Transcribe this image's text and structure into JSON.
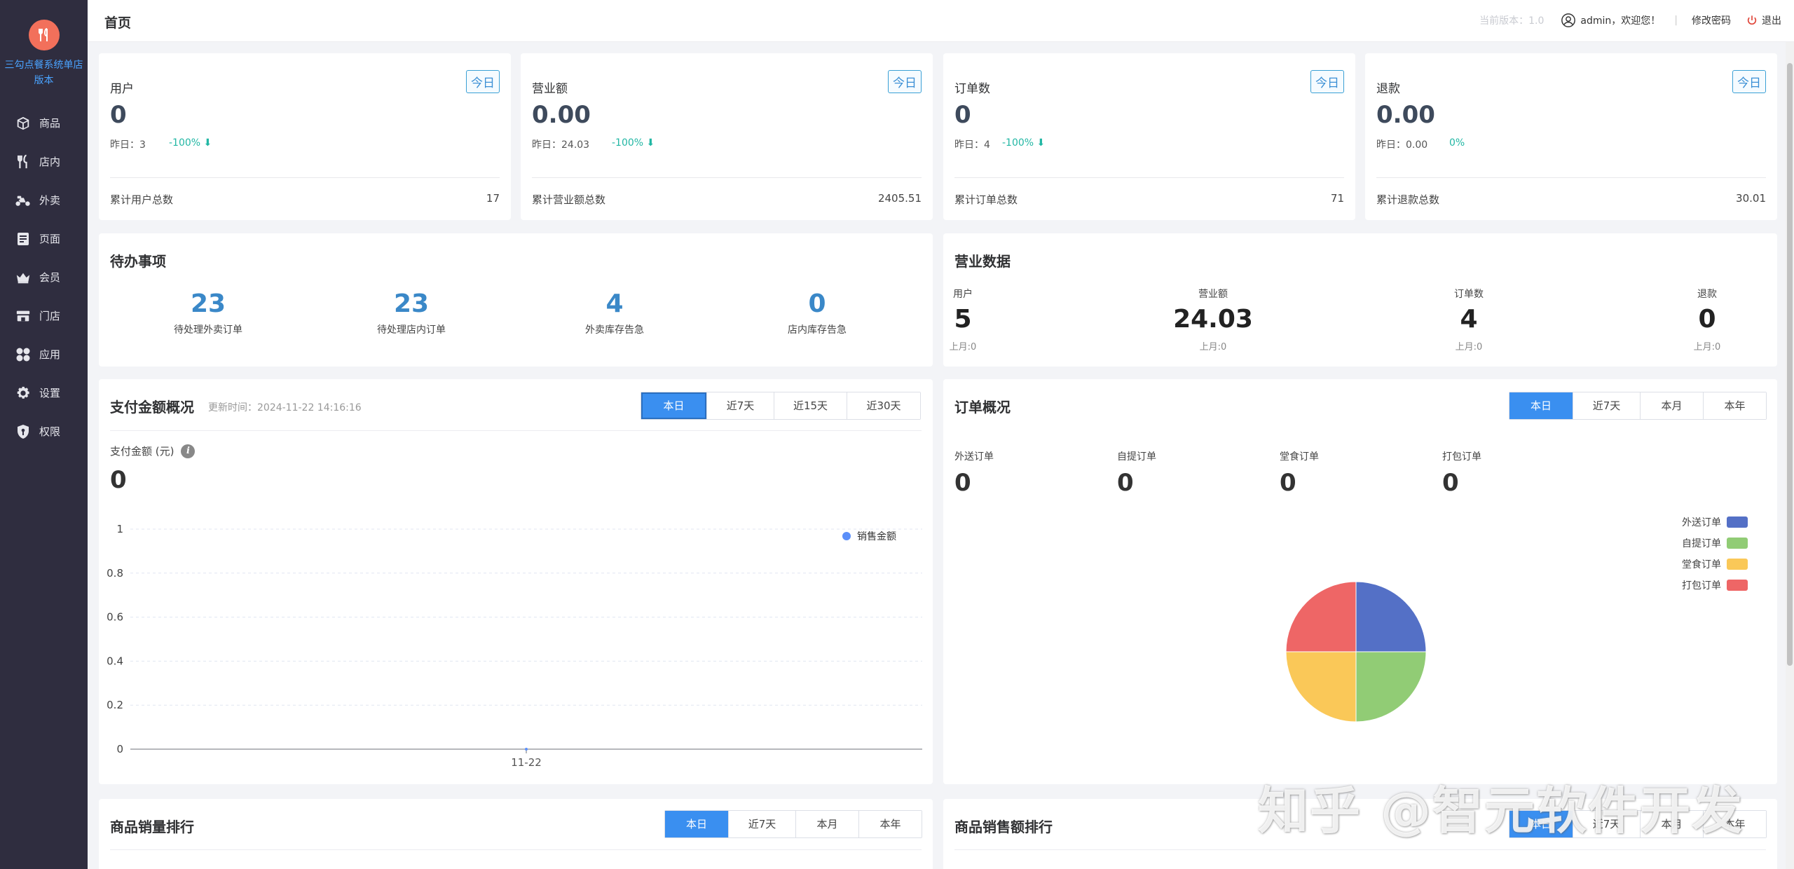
{
  "sidebar": {
    "brand": "三勾点餐系统单店版本",
    "items": [
      {
        "label": "商品",
        "icon": "box-icon"
      },
      {
        "label": "店内",
        "icon": "utensils-icon"
      },
      {
        "label": "外卖",
        "icon": "scooter-icon"
      },
      {
        "label": "页面",
        "icon": "page-icon"
      },
      {
        "label": "会员",
        "icon": "crown-icon"
      },
      {
        "label": "门店",
        "icon": "store-icon"
      },
      {
        "label": "应用",
        "icon": "apps-icon"
      },
      {
        "label": "设置",
        "icon": "gear-icon"
      },
      {
        "label": "权限",
        "icon": "shield-icon"
      }
    ]
  },
  "header": {
    "title": "首页",
    "version": "当前版本：1.0",
    "user": "admin，欢迎您！",
    "separator": "|",
    "change_password": "修改密码",
    "logout": "退出"
  },
  "stats": [
    {
      "label": "用户",
      "badge": "今日",
      "value": "0",
      "yesterday": "昨日：3",
      "change": "-100% ⬇",
      "total_label": "累计用户总数",
      "total": "17"
    },
    {
      "label": "营业额",
      "badge": "今日",
      "value": "0.00",
      "yesterday": "昨日：24.03",
      "change": "-100% ⬇",
      "total_label": "累计营业额总数",
      "total": "2405.51"
    },
    {
      "label": "订单数",
      "badge": "今日",
      "value": "0",
      "yesterday": "昨日：4",
      "change": "-100% ⬇",
      "total_label": "累计订单总数",
      "total": "71"
    },
    {
      "label": "退款",
      "badge": "今日",
      "value": "0.00",
      "yesterday": "昨日：0.00",
      "change": "0%",
      "total_label": "累计退款总数",
      "total": "30.01"
    }
  ],
  "todo": {
    "title": "待办事项",
    "items": [
      {
        "num": "23",
        "label": "待处理外卖订单"
      },
      {
        "num": "23",
        "label": "待处理店内订单"
      },
      {
        "num": "4",
        "label": "外卖库存告急"
      },
      {
        "num": "0",
        "label": "店内库存告急"
      }
    ]
  },
  "business": {
    "title": "营业数据",
    "items": [
      {
        "label": "用户",
        "value": "5",
        "sub": "上月:0"
      },
      {
        "label": "营业额",
        "value": "24.03",
        "sub": "上月:0"
      },
      {
        "label": "订单数",
        "value": "4",
        "sub": "上月:0"
      },
      {
        "label": "退款",
        "value": "0",
        "sub": "上月:0"
      }
    ]
  },
  "payment": {
    "title": "支付金额概况",
    "updated": "更新时间：2024-11-22 14:16:16",
    "tabs": [
      "本日",
      "近7天",
      "近15天",
      "近30天"
    ],
    "active_tab": 0,
    "amount_label": "支付金额 (元)",
    "amount": "0"
  },
  "chart_data": {
    "type": "line",
    "title": "",
    "xlabel": "",
    "ylabel": "",
    "categories": [
      "11-22"
    ],
    "series": [
      {
        "name": "销售金额",
        "values": [
          0
        ]
      }
    ],
    "ylim": [
      0,
      1
    ],
    "yticks": [
      "1",
      "0.8",
      "0.6",
      "0.4",
      "0.2",
      "0"
    ],
    "grid": true,
    "legend": "top-right",
    "colors": {
      "series": "#5b8ff9"
    }
  },
  "orders": {
    "title": "订单概况",
    "tabs": [
      "本日",
      "近7天",
      "本月",
      "本年"
    ],
    "active_tab": 0,
    "types": [
      {
        "label": "外送订单",
        "value": "0"
      },
      {
        "label": "自提订单",
        "value": "0"
      },
      {
        "label": "堂食订单",
        "value": "0"
      },
      {
        "label": "打包订单",
        "value": "0"
      }
    ],
    "legend": [
      {
        "label": "外送订单",
        "color": "#5470c6"
      },
      {
        "label": "自提订单",
        "color": "#91cc75"
      },
      {
        "label": "堂食订单",
        "color": "#fac858"
      },
      {
        "label": "打包订单",
        "color": "#ee6666"
      }
    ],
    "pie_values": [
      1,
      1,
      1,
      1
    ]
  },
  "sales_rank": {
    "title": "商品销量排行",
    "tabs": [
      "本日",
      "近7天",
      "本月",
      "本年"
    ],
    "active_tab": 0
  },
  "revenue_rank": {
    "title": "商品销售额排行",
    "tabs": [
      "本日",
      "近7天",
      "本月",
      "本年"
    ],
    "active_tab": 0
  },
  "watermark": "知乎 @智元软件开发"
}
